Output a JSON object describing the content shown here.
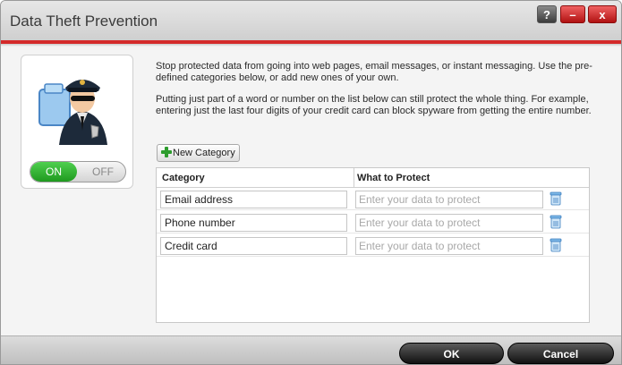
{
  "window": {
    "title": "Data Theft Prevention",
    "help_label": "?",
    "minimize_label": "–",
    "close_label": "x"
  },
  "protection": {
    "on_label": "ON",
    "off_label": "OFF",
    "state": "on"
  },
  "description": {
    "paragraph1": "Stop protected data from going into web pages, email messages, or instant messaging. Use the pre-defined categories below, or add new ones of your own.",
    "paragraph2": "Putting just part of a word or number on the list below can still protect the whole thing. For example, entering just the last four digits of your credit card can block spyware from getting the entire number."
  },
  "toolbar": {
    "new_category_label": "New Category"
  },
  "table": {
    "headers": {
      "category": "Category",
      "what_to_protect": "What to Protect"
    },
    "rows": [
      {
        "category": "Email address",
        "placeholder": "Enter your data to protect"
      },
      {
        "category": "Phone number",
        "placeholder": "Enter your data to protect"
      },
      {
        "category": "Credit card",
        "placeholder": "Enter your data to protect"
      }
    ]
  },
  "footer": {
    "ok_label": "OK",
    "cancel_label": "Cancel"
  },
  "colors": {
    "accent": "#d42a2a",
    "toggle_on": "#2fae2f",
    "button_dark": "#222222"
  }
}
